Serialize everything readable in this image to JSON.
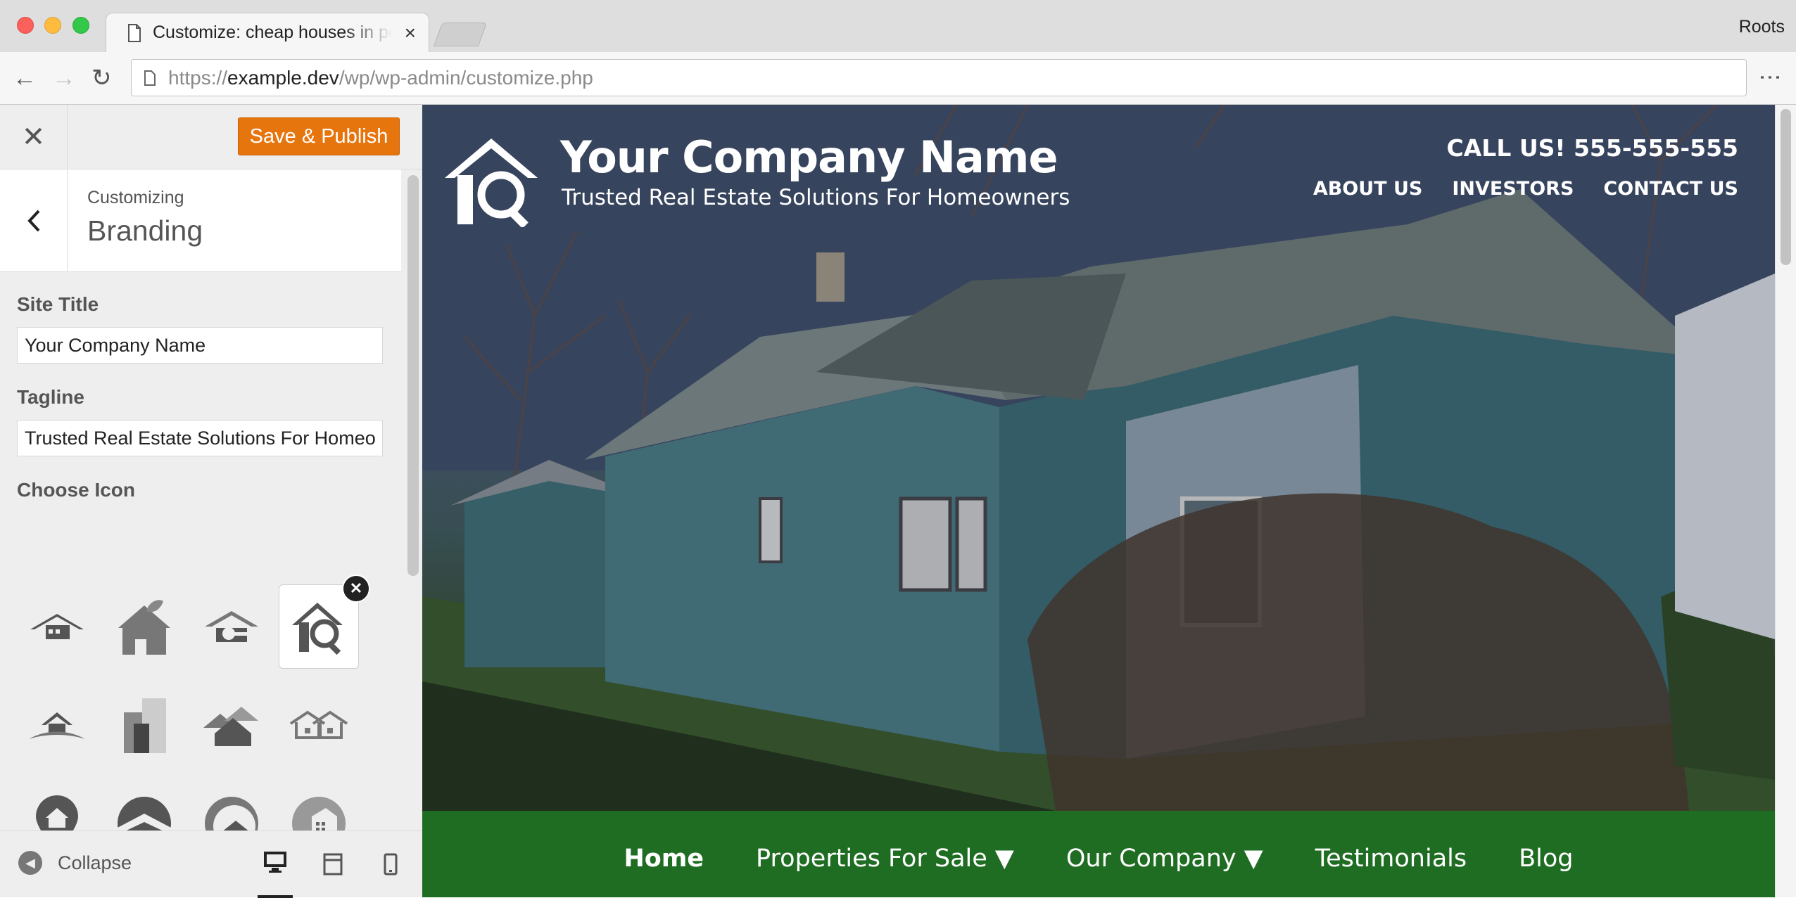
{
  "browser": {
    "tab_title": "Customize: cheap houses in portland",
    "profile_name": "Roots",
    "url_scheme": "https://",
    "url_host": "example.dev",
    "url_path": "/wp/wp-admin/customize.php"
  },
  "customizer": {
    "close_icon": "close-icon",
    "publish_label": "Save & Publish",
    "publish_color": "#e7750d",
    "section_subtitle": "Customizing",
    "section_title": "Branding",
    "site_title_label": "Site Title",
    "site_title_value": "Your Company Name",
    "tagline_label": "Tagline",
    "tagline_value": "Trusted Real Estate Solutions For Homeowners",
    "choose_icon_label": "Choose Icon",
    "icons": [
      "house-roof-icon",
      "leaf-house-icon",
      "house-key-icon",
      "house-magnifier-icon",
      "roof-swoosh-icon",
      "buildings-icon",
      "house-cluster-icon",
      "house-outline-icon",
      "location-pin-house-icon",
      "circle-roof-icon",
      "circle-house-icon",
      "circle-building-icon"
    ],
    "selected_icon": "house-magnifier-icon",
    "collapse_label": "Collapse",
    "devices": [
      "desktop-icon",
      "tablet-icon",
      "mobile-icon"
    ],
    "active_device": "desktop-icon"
  },
  "preview": {
    "site_title": "Your Company Name",
    "tagline": "Trusted Real Estate Solutions For Homeowners",
    "call_us": "CALL US! 555-555-555",
    "top_nav": [
      "ABOUT US",
      "INVESTORS",
      "CONTACT US"
    ],
    "main_nav": [
      "Home",
      "Properties For Sale ▼",
      "Our Company ▼",
      "Testimonials",
      "Blog"
    ],
    "main_nav_current": "Home",
    "main_nav_color": "#1f6d22",
    "hero_image": "abandoned-teal-house-photo"
  }
}
